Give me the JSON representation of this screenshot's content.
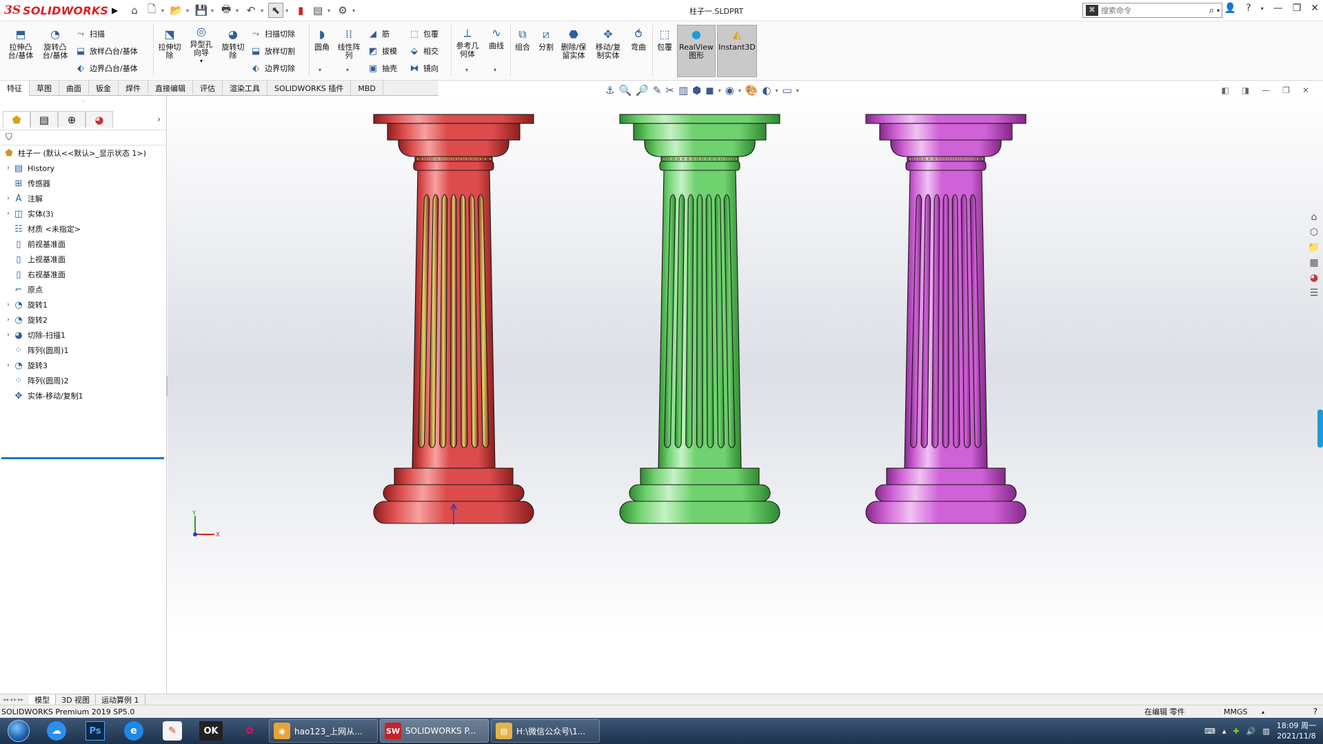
{
  "app": {
    "logo_ds": "3S",
    "logo_name": "SOLIDWORKS",
    "document_title": "柱子一.SLDPRT",
    "search_placeholder": "搜索命令"
  },
  "ribbon": {
    "extrude_boss": "拉伸凸\n台/基体",
    "revolve_boss": "旋转凸\n台/基体",
    "sweep": "扫描",
    "loft_boss": "放样凸台/基体",
    "boundary_boss": "边界凸台/基体",
    "extrude_cut": "拉伸切\n除",
    "hole_wizard": "异型孔\n向导",
    "revolve_cut": "旋转切\n除",
    "swept_cut": "扫描切除",
    "lofted_cut": "放样切割",
    "boundary_cut": "边界切除",
    "fillet": "圆角",
    "linear_pattern": "线性阵\n列",
    "rib": "筋",
    "draft": "拔模",
    "shell": "抽壳",
    "wrap": "包覆",
    "intersect": "相交",
    "mirror": "镜向",
    "ref_geometry": "参考几\n何体",
    "curves": "曲线",
    "combine": "组合",
    "split": "分割",
    "delete_keep_body": "删除/保\n留实体",
    "move_copy_body": "移动/复\n制实体",
    "flex": "弯曲",
    "wrap2": "包覆",
    "realview": "RealView\n图形",
    "instant3d": "Instant3D"
  },
  "cm_tabs": [
    "特征",
    "草图",
    "曲面",
    "钣金",
    "焊件",
    "直接编辑",
    "评估",
    "渲染工具",
    "SOLIDWORKS 插件",
    "MBD"
  ],
  "feature_tree": {
    "root": "柱子一  (默认<<默认>_显示状态 1>)",
    "items": [
      {
        "label": "History",
        "expand": true
      },
      {
        "label": "传感器",
        "expand": false
      },
      {
        "label": "注解",
        "expand": true
      },
      {
        "label": "实体(3)",
        "expand": true
      },
      {
        "label": "材质 <未指定>",
        "expand": false
      },
      {
        "label": "前视基准面",
        "expand": false
      },
      {
        "label": "上视基准面",
        "expand": false
      },
      {
        "label": "右视基准面",
        "expand": false
      },
      {
        "label": "原点",
        "expand": false
      },
      {
        "label": "旋转1",
        "expand": true
      },
      {
        "label": "旋转2",
        "expand": true
      },
      {
        "label": "切除-扫描1",
        "expand": true
      },
      {
        "label": "阵列(圆周)1",
        "expand": false
      },
      {
        "label": "旋转3",
        "expand": true
      },
      {
        "label": "阵列(圆周)2",
        "expand": false
      },
      {
        "label": "实体-移动/复制1",
        "expand": false
      }
    ]
  },
  "bottom_tabs": [
    "模型",
    "3D 视图",
    "运动算例 1"
  ],
  "status": {
    "product": "SOLIDWORKS Premium 2019 SP5.0",
    "edit_mode": "在编辑 零件",
    "units": "MMGS"
  },
  "taskbar": {
    "apps": [
      {
        "label": "hao123_上网从...",
        "color": "#e8a33a",
        "glyph": "◉"
      },
      {
        "label": "SOLIDWORKS P...",
        "color": "#c8212a",
        "glyph": "SW"
      },
      {
        "label": "H:\\微信公众号\\1...",
        "color": "#e0b54a",
        "glyph": "▤"
      }
    ],
    "clock_time": "18:09 周一",
    "clock_date": "2021/11/8"
  },
  "columns": [
    {
      "name": "red-column",
      "base": "#dc4c4c",
      "light": "#f7a0a0",
      "dark": "#8c1e1e",
      "flute": "#dcd86a"
    },
    {
      "name": "green-column",
      "base": "#6fd26f",
      "light": "#c6f2c6",
      "dark": "#2f8a2f",
      "flute": "#6fd26f"
    },
    {
      "name": "purple-column",
      "base": "#cf62d6",
      "light": "#f1c2f4",
      "dark": "#84288a",
      "flute": "#cf62d6"
    }
  ],
  "triad": {
    "x_label": "X",
    "y_label": "Y"
  }
}
